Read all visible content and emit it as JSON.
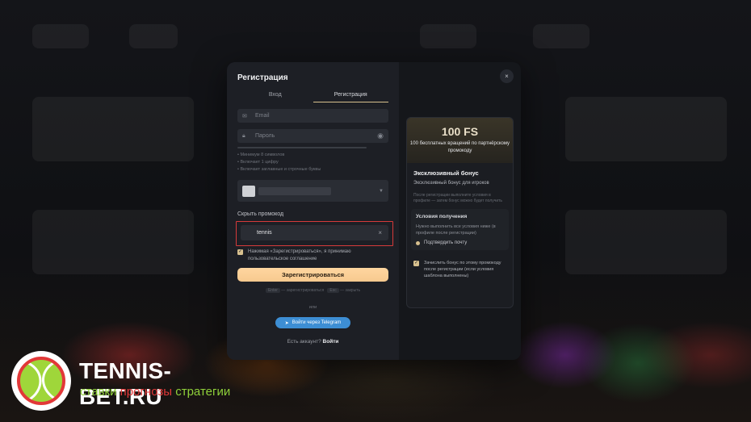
{
  "modal": {
    "title": "Регистрация",
    "tabs": [
      {
        "label": "Вход",
        "active": false
      },
      {
        "label": "Регистрация",
        "active": true
      }
    ],
    "email_placeholder": "Email",
    "password_placeholder": "Пароль",
    "password_rules": [
      "Минимум 8 символов",
      "Включает 1 цифру",
      "Включает заглавные и строчные буквы"
    ],
    "hide_promo_label": "Скрыть промокод",
    "promo_value": "tennis",
    "agreement": "Нажимая «Зарегистрироваться», я принимаю пользовательское соглашение",
    "register_button": "Зарегистрироваться",
    "shortcut_hint": {
      "key1": "Enter",
      "text1": "— зарегистрироваться",
      "key2": "Esc",
      "text2": "— закрыть"
    },
    "or_text": "или",
    "telegram_button": "Войти через Telegram",
    "have_account": "Есть аккаунт?",
    "login_link": "Войти",
    "close_icon": "×"
  },
  "bonus": {
    "amount": "100 FS",
    "subtitle": "100 бесплатных вращений по партнёрскому промокоду",
    "exclusive_title": "Эксклюзивный бонус",
    "exclusive_sub": "Эксклюзивный бонус для игроков",
    "blurred_text": "После регистрации выполните условия в профиле — затем бонус можно будет получить",
    "conditions_title": "Условия получения",
    "conditions_desc": "Нужно выполнить все условия ниже (в профиле после регистрации)",
    "confirm_email": "Подтвердить почту",
    "credit_text": "Зачислить бонус по этому промокоду после регистрации (если условия шаблона выполнены)"
  },
  "brand": {
    "name": "TENNIS-BET.RU",
    "tagline_1": "ставки",
    "tagline_2": "прогнозы",
    "tagline_3": "стратегии"
  },
  "colors": {
    "accent": "#d7c08e",
    "button": "#f7c98f",
    "highlight_border": "#d63a3a",
    "telegram": "#3d8ed4",
    "brand_green": "#8fd03a",
    "brand_red": "#e23838"
  }
}
